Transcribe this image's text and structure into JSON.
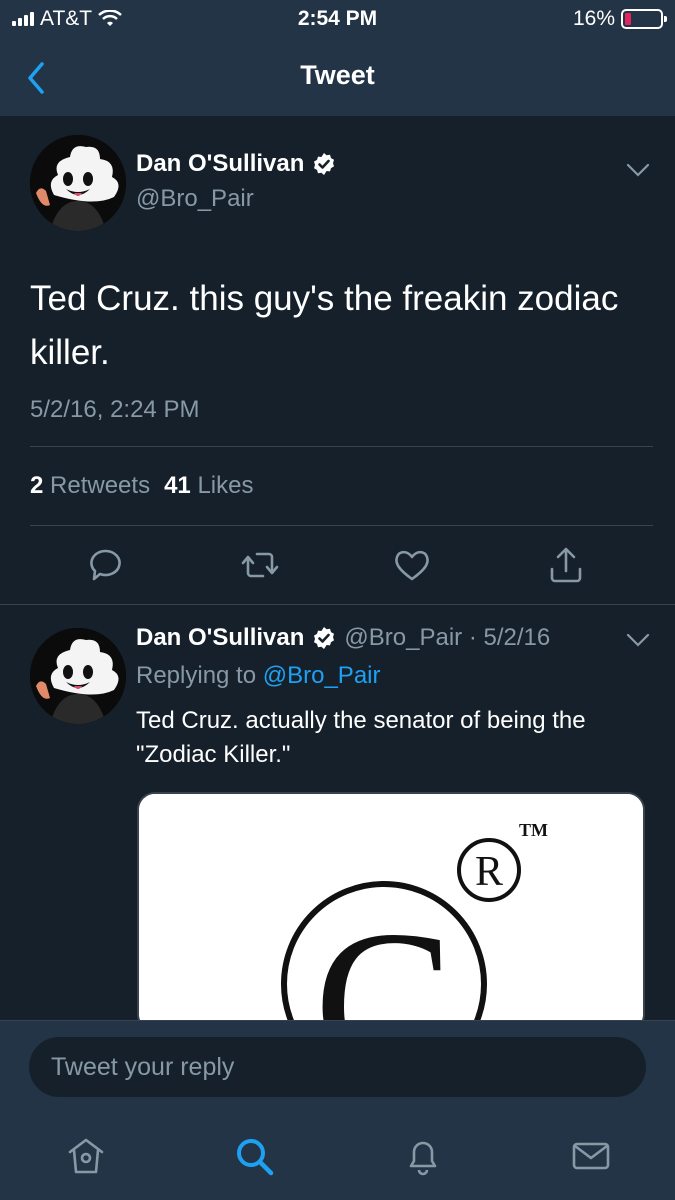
{
  "status_bar": {
    "carrier": "AT&T",
    "time": "2:54 PM",
    "battery": "16%",
    "battery_level": 0.16
  },
  "nav": {
    "title": "Tweet",
    "back_icon": "chevron-left-icon"
  },
  "main_tweet": {
    "author_name": "Dan O'Sullivan",
    "author_handle": "@Bro_Pair",
    "verified": true,
    "text": "Ted Cruz. this guy's the freakin zodiac killer.",
    "timestamp": "5/2/16, 2:24 PM",
    "retweets_count": "2",
    "retweets_label": "Retweets",
    "likes_count": "41",
    "likes_label": "Likes",
    "actions": [
      "reply-icon",
      "retweet-icon",
      "like-icon",
      "share-icon"
    ]
  },
  "reply_tweet": {
    "author_name": "Dan O'Sullivan",
    "author_handle": "@Bro_Pair",
    "date": "5/2/16",
    "meta": "@Bro_Pair · 5/2/16",
    "replying_prefix": "Replying to",
    "replying_to": "@Bro_Pair",
    "text": "Ted Cruz. actually the senator of being the \"Zodiac Killer.\"",
    "media_trademark": "TM",
    "media_registered": "R",
    "media_copyright": "C"
  },
  "composer": {
    "placeholder": "Tweet your reply"
  },
  "tab_bar": {
    "items": [
      "home-icon",
      "search-icon",
      "notifications-icon",
      "messages-icon"
    ],
    "active": "search-icon"
  },
  "colors": {
    "background": "#15202b",
    "surface": "#243447",
    "accent": "#1da1f2",
    "muted": "#8899a6"
  }
}
